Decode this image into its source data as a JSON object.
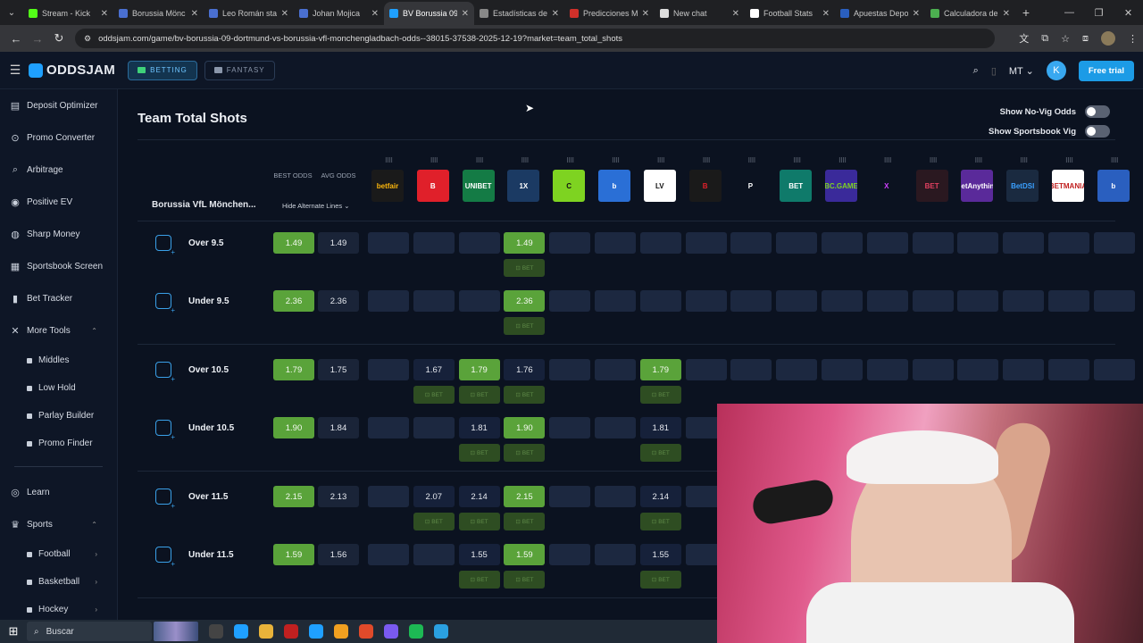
{
  "browser": {
    "tabs": [
      {
        "label": "Stream - Kick",
        "color": "#53fc18",
        "active": false
      },
      {
        "label": "Borussia Mönc",
        "color": "#4a6fd0",
        "active": false
      },
      {
        "label": "Leo Román sta",
        "color": "#4a6fd0",
        "active": false
      },
      {
        "label": "Johan Mojica",
        "color": "#4a6fd0",
        "active": false
      },
      {
        "label": "BV Borussia 09",
        "color": "#1fa0ff",
        "active": true
      },
      {
        "label": "Estadísticas de",
        "color": "#888888",
        "active": false
      },
      {
        "label": "Predicciones M",
        "color": "#d0302a",
        "active": false
      },
      {
        "label": "New chat",
        "color": "#dddddd",
        "active": false
      },
      {
        "label": "Football Stats",
        "color": "#ffffff",
        "active": false
      },
      {
        "label": "Apuestas Depo",
        "color": "#2a5fbf",
        "active": false
      },
      {
        "label": "Calculadora de",
        "color": "#4caf50",
        "active": false
      }
    ],
    "url": "oddsjam.com/game/bv-borussia-09-dortmund-vs-borussia-vfl-monchengladbach-odds--38015-37538-2025-12-19?market=team_total_shots"
  },
  "header": {
    "logo": "ODDSJAM",
    "betting_label": "BETTING",
    "fantasy_label": "FANTASY",
    "region": "MT",
    "avatar_initial": "K",
    "free_trial": "Free trial",
    "accent": "#1c9be6"
  },
  "sidebar": {
    "items": [
      {
        "label": "Deposit Optimizer",
        "icon": "deposit-icon"
      },
      {
        "label": "Promo Converter",
        "icon": "promo-icon"
      },
      {
        "label": "Arbitrage",
        "icon": "arbitrage-icon"
      },
      {
        "label": "Positive EV",
        "icon": "ev-icon"
      },
      {
        "label": "Sharp Money",
        "icon": "money-icon"
      },
      {
        "label": "Sportsbook Screen",
        "icon": "grid-icon"
      },
      {
        "label": "Bet Tracker",
        "icon": "chart-icon"
      },
      {
        "label": "More Tools",
        "icon": "tools-icon"
      }
    ],
    "tools": [
      "Middles",
      "Low Hold",
      "Parlay Builder",
      "Promo Finder"
    ],
    "learn": "Learn",
    "sports": "Sports",
    "sport_items": [
      "Football",
      "Basketball",
      "Hockey"
    ]
  },
  "main": {
    "title": "Team Total Shots",
    "toggle_novig": "Show No-Vig Odds",
    "toggle_vig": "Show Sportsbook Vig",
    "team": "Borussia VfL Mönchen...",
    "best_odds": "BEST ODDS",
    "avg_odds": "AVG ODDS",
    "hide_alt": "Hide Alternate Lines",
    "bet_label": "BET",
    "books": [
      {
        "name": "betfair",
        "color": "#1a1a1a",
        "fg": "#ffb80c"
      },
      {
        "name": "B",
        "color": "#e0202a",
        "fg": "#ffffff"
      },
      {
        "name": "UNIBET",
        "color": "#147b45",
        "fg": "#ffffff"
      },
      {
        "name": "1X",
        "color": "#1b3a63",
        "fg": "#ffffff"
      },
      {
        "name": "C",
        "color": "#7ed321",
        "fg": "#111111"
      },
      {
        "name": "b",
        "color": "#2a6fd6",
        "fg": "#ffffff"
      },
      {
        "name": "LV",
        "color": "#ffffff",
        "fg": "#111111"
      },
      {
        "name": "B",
        "color": "#1a1a1a",
        "fg": "#e0202a"
      },
      {
        "name": "P",
        "color": "#0b1220",
        "fg": "#ffffff"
      },
      {
        "name": "BET",
        "color": "#0f7a6a",
        "fg": "#ffffff"
      },
      {
        "name": "BC.GAME",
        "color": "#3a2a9a",
        "fg": "#7ed321"
      },
      {
        "name": "X",
        "color": "#0b1220",
        "fg": "#d040ff"
      },
      {
        "name": "BET",
        "color": "#2a1820",
        "fg": "#e04060"
      },
      {
        "name": "BetAnything",
        "color": "#5a2a9a",
        "fg": "#ffffff"
      },
      {
        "name": "BetDSI",
        "color": "#1a2a40",
        "fg": "#3aa0ff"
      },
      {
        "name": "BETMANIA",
        "color": "#ffffff",
        "fg": "#c02020"
      },
      {
        "name": "b",
        "color": "#2a5fbf",
        "fg": "#ffffff"
      }
    ],
    "rows": [
      {
        "label": "Over 9.5",
        "best": "1.49",
        "avg": "1.49",
        "odds": [
          "",
          "",
          "",
          "1.49",
          "",
          "",
          "",
          "",
          "",
          "",
          "",
          "",
          "",
          "",
          "",
          "",
          ""
        ],
        "green": [
          3
        ],
        "bets": [
          3
        ]
      },
      {
        "label": "Under 9.5",
        "best": "2.36",
        "avg": "2.36",
        "odds": [
          "",
          "",
          "",
          "2.36",
          "",
          "",
          "",
          "",
          "",
          "",
          "",
          "",
          "",
          "",
          "",
          "",
          ""
        ],
        "green": [
          3
        ],
        "bets": [
          3
        ]
      },
      {
        "label": "Over 10.5",
        "best": "1.79",
        "avg": "1.75",
        "odds": [
          "",
          "1.67",
          "1.79",
          "1.76",
          "",
          "",
          "1.79",
          "",
          "",
          "",
          "",
          "",
          "",
          "",
          "",
          "",
          ""
        ],
        "green": [
          2,
          6
        ],
        "bets": [
          1,
          2,
          3,
          6
        ]
      },
      {
        "label": "Under 10.5",
        "best": "1.90",
        "avg": "1.84",
        "odds": [
          "",
          "",
          "1.81",
          "1.90",
          "",
          "",
          "1.81",
          "",
          "",
          "",
          "",
          "",
          "",
          "",
          "",
          "",
          ""
        ],
        "green": [
          3
        ],
        "bets": [
          2,
          3,
          6
        ]
      },
      {
        "label": "Over 11.5",
        "best": "2.15",
        "avg": "2.13",
        "odds": [
          "",
          "2.07",
          "2.14",
          "2.15",
          "",
          "",
          "2.14",
          "",
          "",
          "",
          "",
          "",
          "",
          "",
          "",
          "",
          ""
        ],
        "green": [
          3
        ],
        "bets": [
          1,
          2,
          3,
          6
        ]
      },
      {
        "label": "Under 11.5",
        "best": "1.59",
        "avg": "1.56",
        "odds": [
          "",
          "",
          "1.55",
          "1.59",
          "",
          "",
          "1.55",
          "",
          "",
          "",
          "",
          "",
          "",
          "",
          "",
          "",
          ""
        ],
        "green": [
          3
        ],
        "bets": [
          2,
          3,
          6
        ]
      }
    ]
  },
  "taskbar": {
    "search": "Buscar"
  }
}
